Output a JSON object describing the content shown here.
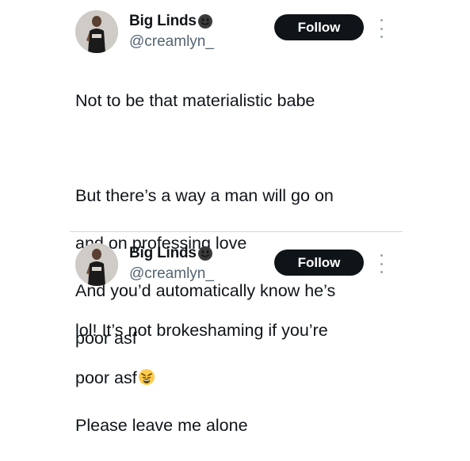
{
  "tweets": [
    {
      "author": {
        "name": "Big Linds",
        "handle": "@creamlyn_",
        "name_emoji": "dark-smiling-face-emoji"
      },
      "follow_label": "Follow",
      "lines": [
        "Not to be that materialistic babe",
        "",
        "But there’s a way a man will go on",
        "and on professing love",
        "And you’d automatically know he’s",
        "poor asf"
      ]
    },
    {
      "author": {
        "name": "Big Linds",
        "handle": "@creamlyn_",
        "name_emoji": "dark-smiling-face-emoji"
      },
      "follow_label": "Follow",
      "lines": [
        "lol! It’s not brokeshaming if you’re",
        "poor asf",
        "Please leave me alone"
      ],
      "line_emoji": {
        "line_index": 1,
        "icon": "weary-face-emoji"
      }
    }
  ],
  "colors": {
    "follow_bg": "#0f1419",
    "handle": "#536471",
    "divider": "#cfd9de"
  }
}
